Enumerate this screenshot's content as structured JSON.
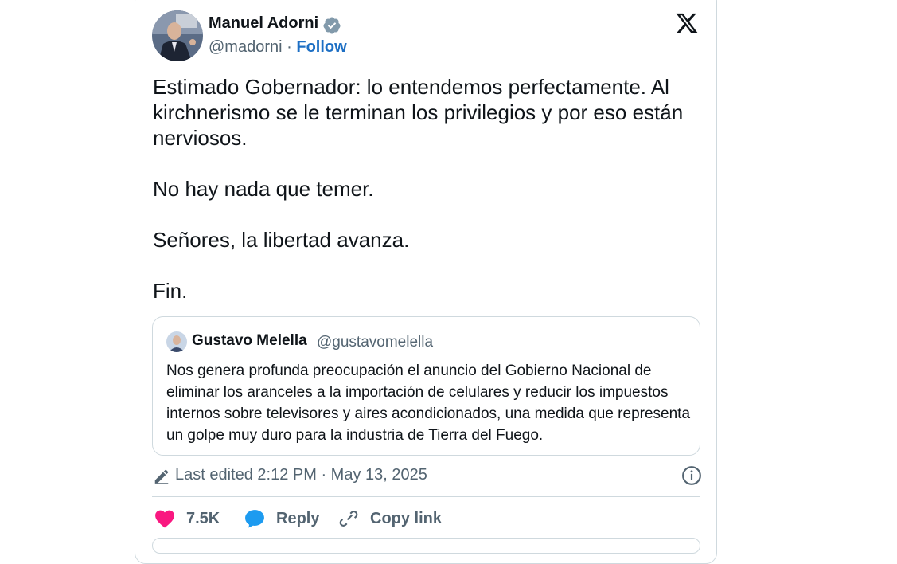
{
  "tweet": {
    "author_name": "Manuel Adorni",
    "handle": "@madorni",
    "separator": "·",
    "follow_label": "Follow",
    "paragraphs": [
      "Estimado Gobernador: lo entendemos perfectamente. Al kirchnerismo se le terminan los privilegios y por eso están nerviosos.",
      "No hay nada que temer.",
      "Señores, la libertad avanza.",
      "Fin."
    ],
    "verified_icon": "verified-badge-icon",
    "brand_icon": "x-logo-icon"
  },
  "quoted": {
    "author_name": "Gustavo Melella",
    "handle": "@gustavomelella",
    "text": "Nos genera profunda preocupación el anuncio del Gobierno Nacional de eliminar los aranceles a la importación de celulares y reducir los impuestos internos sobre televisores y aires acondicionados, una medida que representa un golpe muy duro para la industria de Tierra del Fuego."
  },
  "meta": {
    "edited_label": "Last edited 2:12 PM · May 13, 2025"
  },
  "actions": {
    "likes_count": "7.5K",
    "reply_label": "Reply",
    "copy_link_label": "Copy link"
  },
  "colors": {
    "like": "#f91880",
    "reply": "#1d9bf0",
    "link": "#1d6fc4",
    "verified": "#829aab",
    "border": "#cfd9de",
    "muted": "#536471"
  }
}
